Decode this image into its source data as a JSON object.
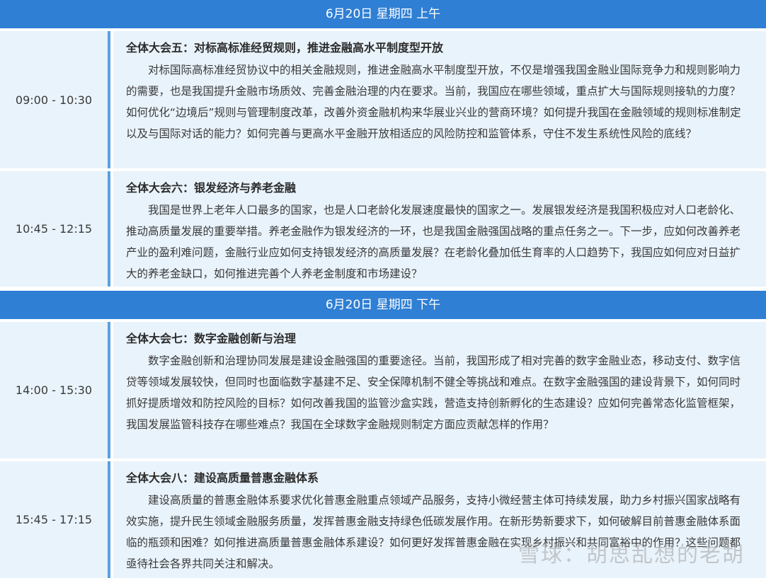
{
  "sections": [
    {
      "header": "6月20日 星期四 上午",
      "rows": [
        {
          "time": "09:00 - 10:30",
          "title": "全体大会五：对标高标准经贸规则，推进金融高水平制度型开放",
          "body": "对标国际高标准经贸协议中的相关金融规则，推进金融高水平制度型开放，不仅是增强我国金融业国际竞争力和规则影响力的需要，也是我国提升金融市场质效、完善金融治理的内在要求。当前，我国应在哪些领域，重点扩大与国际规则接轨的力度？如何优化“边境后”规则与管理制度改革，改善外资金融机构来华展业兴业的营商环境？如何提升我国在金融领域的规则标准制定以及与国际对话的能力？如何完善与更高水平金融开放相适应的风险防控和监管体系，守住不发生系统性风险的底线？"
        },
        {
          "time": "10:45 - 12:15",
          "title": "全体大会六：银发经济与养老金融",
          "body": "我国是世界上老年人口最多的国家，也是人口老龄化发展速度最快的国家之一。发展银发经济是我国积极应对人口老龄化、推动高质量发展的重要举措。养老金融作为银发经济的一环，也是我国金融强国战略的重点任务之一。下一步，应如何改善养老产业的盈利难问题，金融行业应如何支持银发经济的高质量发展？在老龄化叠加低生育率的人口趋势下，我国应如何应对日益扩大的养老金缺口，如何推进完善个人养老金制度和市场建设？"
        }
      ]
    },
    {
      "header": "6月20日 星期四 下午",
      "rows": [
        {
          "time": "14:00 - 15:30",
          "title": "全体大会七：数字金融创新与治理",
          "body": "数字金融创新和治理协同发展是建设金融强国的重要途径。当前，我国形成了相对完善的数字金融业态，移动支付、数字信贷等领域发展较快，但同时也面临数字基建不足、安全保障机制不健全等挑战和难点。在数字金融强国的建设背景下，如何同时抓好提质增效和防控风险的目标？如何改善我国的监管沙盒实践，营造支持创新孵化的生态建设？应如何完善常态化监管框架，我国发展监管科技存在哪些难点？我国在全球数字金融规则制定方面应贡献怎样的作用？"
        },
        {
          "time": "15:45 - 17:15",
          "title": "全体大会八：建设高质量普惠金融体系",
          "body": "建设高质量的普惠金融体系要求优化普惠金融重点领域产品服务，支持小微经营主体可持续发展，助力乡村振兴国家战略有效实施，提升民生领域金融服务质量，发挥普惠金融支持绿色低碳发展作用。在新形势新要求下，如何破解目前普惠金融体系面临的瓶颈和困难？如何推进高质量普惠金融体系建设？如何更好发挥普惠金融在实现乡村振兴和共同富裕中的作用？这些问题都亟待社会各界共同关注和解决。"
        }
      ]
    }
  ],
  "watermark": "雪球：胡思乱想的老胡",
  "colors": {
    "header_bg": "#2f7fd4",
    "cell_bg": "#e9f3fb",
    "accent_border": "#5aa1e0"
  }
}
